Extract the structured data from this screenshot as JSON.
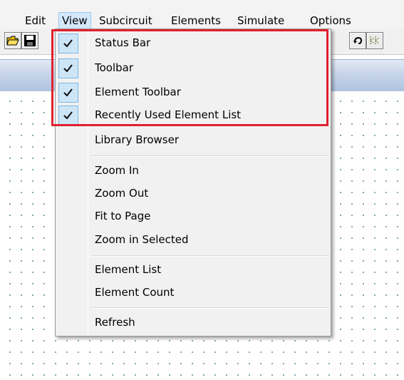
{
  "menubar": {
    "items": [
      {
        "label": "Edit"
      },
      {
        "label": "View"
      },
      {
        "label": "Subcircuit"
      },
      {
        "label": "Elements"
      },
      {
        "label": "Simulate"
      },
      {
        "label": "Options"
      }
    ],
    "active": "View"
  },
  "toolbar": {
    "icons": [
      "open-folder-icon",
      "save-icon",
      "undo-icon",
      "transistor-icon"
    ]
  },
  "view_menu": {
    "items": [
      {
        "label": "Status Bar",
        "checked": true
      },
      {
        "label": "Toolbar",
        "checked": true
      },
      {
        "label": "Element Toolbar",
        "checked": true
      },
      {
        "label": "Recently Used Element List",
        "checked": true
      },
      {
        "label": "Library Browser",
        "checked": false
      },
      {
        "label": "Zoom In",
        "checked": false
      },
      {
        "label": "Zoom Out",
        "checked": false
      },
      {
        "label": "Fit to Page",
        "checked": false
      },
      {
        "label": "Zoom in Selected",
        "checked": false
      },
      {
        "label": "Element List",
        "checked": false
      },
      {
        "label": "Element Count",
        "checked": false
      },
      {
        "label": "Refresh",
        "checked": false
      }
    ]
  },
  "colors": {
    "highlight": "#e0202e",
    "check_bg": "#cde6f7",
    "canvas_dot": "#6a9bb0"
  }
}
